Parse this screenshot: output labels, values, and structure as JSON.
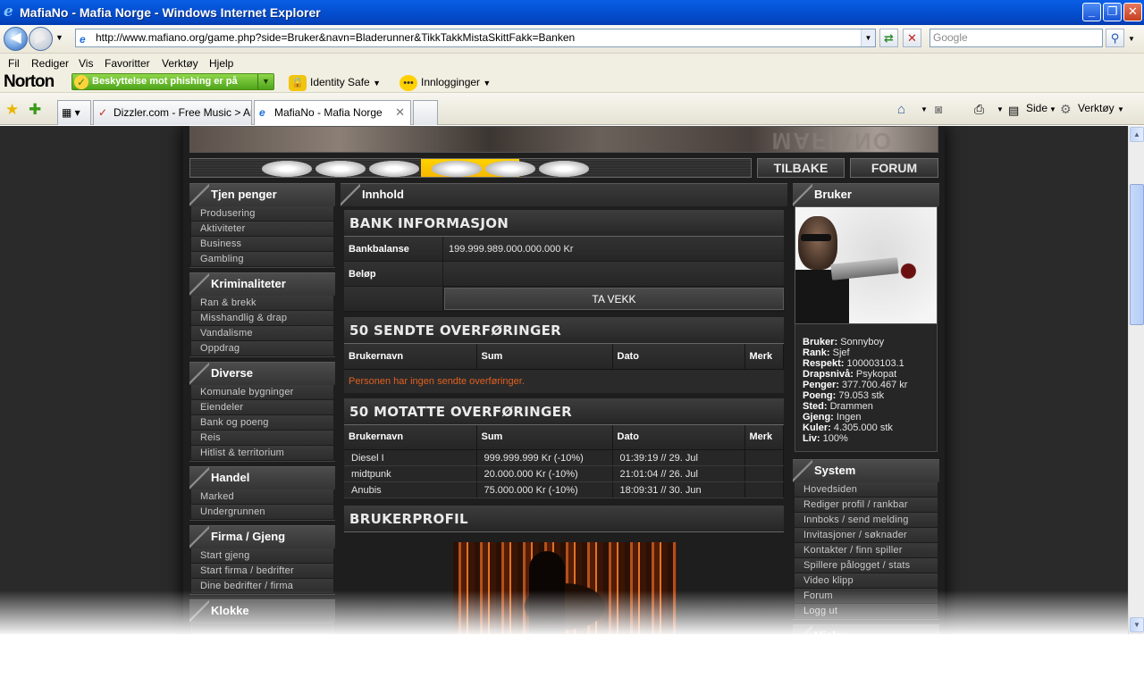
{
  "window": {
    "title": "MafiaNo - Mafia Norge - Windows Internet Explorer",
    "minimize": "_",
    "maximize": "❐",
    "close": "✕"
  },
  "address": {
    "url": "http://www.mafiano.org/game.php?side=Bruker&navn=Bladerunner&TikkTakkMistaSkittFakk=Banken",
    "search_placeholder": "Google"
  },
  "menu": [
    "Fil",
    "Rediger",
    "Vis",
    "Favoritter",
    "Verktøy",
    "Hjelp"
  ],
  "norton": {
    "logo": "Norton",
    "phishing": "Beskyttelse mot phishing er på",
    "identity_safe": "Identity Safe",
    "logins": "Innlogginger"
  },
  "tabs": [
    {
      "label": "Dizzler.com - Free Music > Ar..."
    },
    {
      "label": "MafiaNo - Mafia Norge"
    }
  ],
  "commandbar": {
    "page": "Side",
    "tools": "Verktøy"
  },
  "site": {
    "buttons": {
      "back": "TILBAKE",
      "forum": "FORUM"
    },
    "left_menu": [
      {
        "heading": "Tjen penger",
        "items": [
          "Produsering",
          "Aktiviteter",
          "Business",
          "Gambling"
        ]
      },
      {
        "heading": "Kriminaliteter",
        "items": [
          "Ran & brekk",
          "Misshandlig & drap",
          "Vandalisme",
          "Oppdrag"
        ]
      },
      {
        "heading": "Diverse",
        "items": [
          "Komunale bygninger",
          "Eiendeler",
          "Bank og poeng",
          "Reis",
          "Hitlist & territorium"
        ]
      },
      {
        "heading": "Handel",
        "items": [
          "Marked",
          "Undergrunnen"
        ]
      },
      {
        "heading": "Firma / Gjeng",
        "items": [
          "Start gjeng",
          "Start firma / bedrifter",
          "Dine bedrifter / firma"
        ]
      },
      {
        "heading": "Klokke",
        "items": []
      }
    ],
    "content_heading": "Innhold",
    "bank": {
      "title": "BANK INFORMASJON",
      "balance_label": "Bankbalanse",
      "balance_value": "199.999.989.000.000.000 Kr",
      "amount_label": "Beløp",
      "withdraw_button": "TA VEKK"
    },
    "sent": {
      "title": "50 SENDTE OVERFØRINGER",
      "headers": [
        "Brukernavn",
        "Sum",
        "Dato",
        "Merk"
      ],
      "empty": "Personen har ingen sendte overføringer."
    },
    "received": {
      "title": "50 MOTATTE OVERFØRINGER",
      "headers": [
        "Brukernavn",
        "Sum",
        "Dato",
        "Merk"
      ],
      "rows": [
        {
          "user": "Diesel I",
          "sum": "999.999.999 Kr (-10%)",
          "date": "01:39:19 // 29. Jul",
          "mark": ""
        },
        {
          "user": "midtpunk",
          "sum": "20.000.000 Kr (-10%)",
          "date": "21:01:04 // 26. Jul",
          "mark": ""
        },
        {
          "user": "Anubis",
          "sum": "75.000.000 Kr (-10%)",
          "date": "18:09:31 // 30. Jun",
          "mark": ""
        }
      ]
    },
    "profile_title": "BRUKERPROFIL",
    "user": {
      "heading": "Bruker",
      "stats": [
        {
          "k": "Bruker:",
          "v": "Sonnyboy"
        },
        {
          "k": "Rank:",
          "v": "Sjef"
        },
        {
          "k": "Respekt:",
          "v": "100003103.1"
        },
        {
          "k": "Drapsnivå:",
          "v": "Psykopat"
        },
        {
          "k": "Penger:",
          "v": "377.700.467 kr"
        },
        {
          "k": "Poeng:",
          "v": "79.053 stk"
        },
        {
          "k": "Sted:",
          "v": "Drammen"
        },
        {
          "k": "Gjeng:",
          "v": "Ingen"
        },
        {
          "k": "Kuler:",
          "v": "4.305.000 stk"
        },
        {
          "k": "Liv:",
          "v": "100%"
        }
      ]
    },
    "system": {
      "heading": "System",
      "items": [
        "Hovedsiden",
        "Rediger profil / rankbar",
        "Innboks / send melding",
        "Invitasjoner / søknader",
        "Kontakter / finn spiller",
        "Spillere pålogget / stats",
        "Video klipp",
        "Forum",
        "Logg ut"
      ]
    },
    "help_heading": "Hjelp:"
  }
}
